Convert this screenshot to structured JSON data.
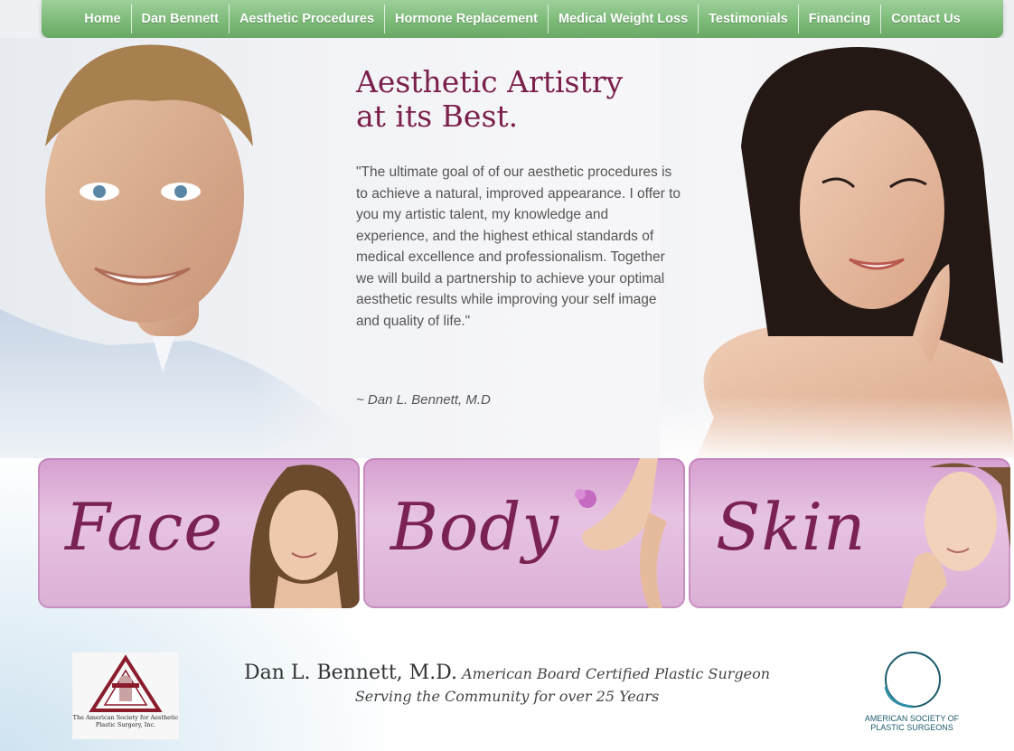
{
  "nav": {
    "items": [
      {
        "label": "Home"
      },
      {
        "label": "Dan Bennett"
      },
      {
        "label": "Aesthetic Procedures"
      },
      {
        "label": "Hormone Replacement"
      },
      {
        "label": "Medical Weight Loss"
      },
      {
        "label": "Testimonials"
      },
      {
        "label": "Financing"
      },
      {
        "label": "Contact Us"
      }
    ]
  },
  "hero": {
    "headline_line1": "Aesthetic Artistry",
    "headline_line2": "at its Best.",
    "quote": "\"The ultimate goal of of our aesthetic procedures is to achieve a natural, improved appearance. I offer to you my artistic talent, my knowledge and experience, and the highest ethical standards of medical excellence and professionalism. Together we will build a partnership to achieve your optimal aesthetic results while improving your self image and quality of life.\"",
    "signature": "~ Dan L. Bennett, M.D"
  },
  "tiles": [
    {
      "label": "Face"
    },
    {
      "label": "Body"
    },
    {
      "label": "Skin"
    }
  ],
  "footer": {
    "name": "Dan L. Bennett, M.D.",
    "credential": "American Board Certified Plastic Surgeon",
    "serving": "Serving the Community for over 25 Years",
    "left_logo_caption": "The American Society for Aesthetic Plastic Surgery, Inc.",
    "right_logo_caption": "AMERICAN SOCIETY OF PLASTIC SURGEONS"
  },
  "colors": {
    "nav_green": "#7dbb79",
    "headline_plum": "#7b1f4b",
    "tile_pink": "#e7c3e2",
    "asps_teal": "#1b5a6c"
  }
}
